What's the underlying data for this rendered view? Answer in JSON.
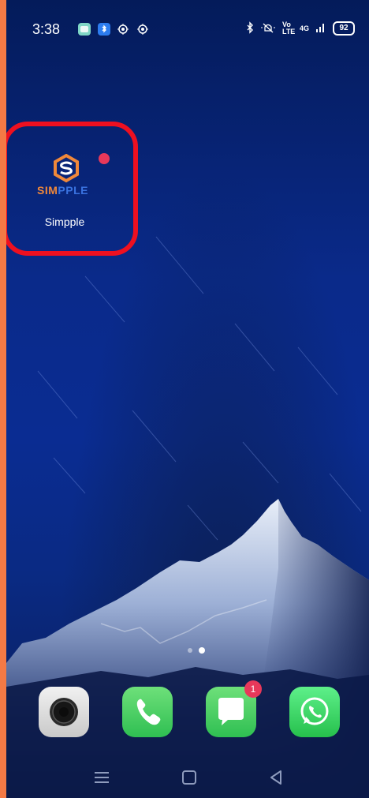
{
  "status_bar": {
    "time": "3:38",
    "network_label": "4G",
    "volte_label": "Vo LTE",
    "battery": "92"
  },
  "home": {
    "highlighted_app": {
      "label": "Simpple",
      "logo_text": "SIMPPLE",
      "highlight_color": "#ee1020",
      "notification_dot_color": "#e8385a"
    }
  },
  "dock": {
    "apps": [
      {
        "name": "Camera",
        "icon": "camera-icon"
      },
      {
        "name": "Phone",
        "icon": "phone-icon"
      },
      {
        "name": "Messages",
        "icon": "message-icon",
        "badge": "1"
      },
      {
        "name": "WhatsApp",
        "icon": "whatsapp-icon"
      }
    ]
  },
  "page_indicator": {
    "pages": 2,
    "active": 2
  },
  "nav_bar": {
    "buttons": [
      "menu-icon",
      "home-icon",
      "back-icon"
    ]
  }
}
